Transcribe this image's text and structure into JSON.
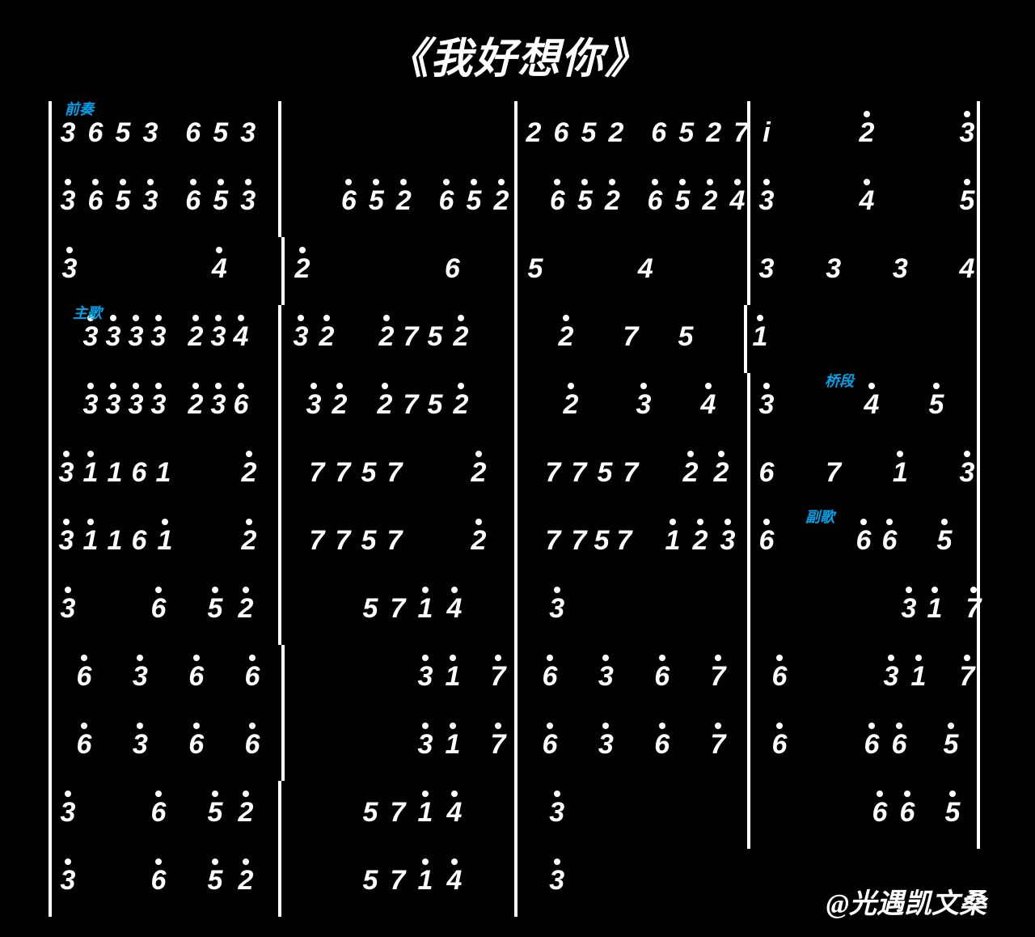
{
  "title": "《我好想你》",
  "credit": "@光遇凯文桑",
  "labels": {
    "prelude": "前奏",
    "verse": "主歌",
    "bridge": "桥段",
    "chorus": "副歌"
  },
  "barFullWidth": 288,
  "lines": [
    {
      "label": {
        "key": "prelude",
        "cls": "lbl-0"
      },
      "bars": [
        {
          "divL": true,
          "divR": true,
          "notation": "3653 653"
        },
        {
          "divL": false,
          "divR": false,
          "notation": ""
        },
        {
          "divL": true,
          "divR": false,
          "notation": "2652 6527"
        },
        {
          "divL": true,
          "divR": true,
          "notation": "i 2' 3'",
          "spread": true
        }
      ]
    },
    {
      "label": null,
      "bars": [
        {
          "divL": true,
          "divR": true,
          "notation": "3'6'5'3' 6'5'3'"
        },
        {
          "divL": false,
          "divR": false,
          "notation": "6'5'2' 6'5'2'",
          "right": true
        },
        {
          "divL": true,
          "divR": false,
          "notation": "6'5'2' 6'5'2'4'",
          "right": true
        },
        {
          "divL": true,
          "divR": true,
          "notation": "3' 4' 5'",
          "spread": true
        }
      ]
    },
    {
      "label": null,
      "bars": [
        {
          "divL": true,
          "divR": false,
          "notation": "3'   4'",
          "spread2": true
        },
        {
          "divL": true,
          "divR": false,
          "notation": "2'   6",
          "spread2": true
        },
        {
          "divL": true,
          "divR": false,
          "notation": "5  4",
          "spread2c": true
        },
        {
          "divL": true,
          "divR": true,
          "notation": "3 3 3 4",
          "spread": true
        }
      ]
    },
    {
      "label": {
        "key": "verse",
        "cls": "lbl-3"
      },
      "bars": [
        {
          "divL": true,
          "divR": true,
          "notation": " 3'3'3'3' 2'3'4'",
          "tight": true,
          "pad": 18
        },
        {
          "divL": false,
          "divR": false,
          "notation": "3'2'  2'752'",
          "custom": "c_r4a"
        },
        {
          "divL": true,
          "divR": true,
          "notation": " 2' 7 5",
          "custom": "c_r4b"
        },
        {
          "divL": false,
          "divR": true,
          "notation": "1'",
          "pad": 4
        }
      ]
    },
    {
      "label": {
        "key": "bridge",
        "cls": "lbl-4"
      },
      "bars": [
        {
          "divL": true,
          "divR": true,
          "notation": " 3'3'3'3' 2'3'6'",
          "tight": true,
          "pad": 18
        },
        {
          "divL": false,
          "divR": false,
          "notation": " 3'2' 2'752'",
          "custom": "c_r5a"
        },
        {
          "divL": true,
          "divR": false,
          "notation": " 2' 3' 4'",
          "custom": "c_r5b"
        },
        {
          "divL": true,
          "divR": true,
          "notation": "3'  4' 5'",
          "custom": "c_r5c"
        }
      ]
    },
    {
      "label": null,
      "bars": [
        {
          "divL": true,
          "divR": true,
          "notation": "3'1'161  2'",
          "custom": "c_r6a"
        },
        {
          "divL": false,
          "divR": false,
          "notation": " 7757  2'",
          "custom": "c_r6b"
        },
        {
          "divL": true,
          "divR": false,
          "notation": " 7757 2'2'",
          "custom": "c_r6c"
        },
        {
          "divL": true,
          "divR": true,
          "notation": "6 7 1' 3'",
          "spread": true
        }
      ]
    },
    {
      "label": {
        "key": "chorus",
        "cls": "lbl-6"
      },
      "bars": [
        {
          "divL": true,
          "divR": true,
          "notation": "3'1'161'  2'",
          "custom": "c_r7a"
        },
        {
          "divL": false,
          "divR": false,
          "notation": " 7757  2'",
          "custom": "c_r6b"
        },
        {
          "divL": true,
          "divR": false,
          "notation": " 7757 1'2'3'",
          "custom": "c_r7c"
        },
        {
          "divL": true,
          "divR": true,
          "notation": "6'  6'6' 5'",
          "custom": "c_r7d"
        }
      ]
    },
    {
      "label": null,
      "bars": [
        {
          "divL": true,
          "divR": true,
          "notation": "3'  6' 5'2'",
          "custom": "c_r8a"
        },
        {
          "divL": false,
          "divR": false,
          "notation": "  571' 4'",
          "custom": "c_r8b"
        },
        {
          "divL": true,
          "divR": false,
          "notation": " 3'",
          "pad": 18
        },
        {
          "divL": true,
          "divR": true,
          "notation": "   3'1' 7'",
          "custom": "c_r8d"
        }
      ]
    },
    {
      "label": null,
      "bars": [
        {
          "divL": true,
          "divR": false,
          "notation": " 6' 3' 6' 6'",
          "spreadIn": true
        },
        {
          "divL": true,
          "divR": false,
          "notation": "   3'1' 7'",
          "custom": "c_r9b"
        },
        {
          "divL": true,
          "divR": false,
          "notation": " 6' 3' 6' 7'",
          "spreadIn": true
        },
        {
          "divL": true,
          "divR": true,
          "notation": " 6'  3'1' 7'",
          "custom": "c_r9d"
        }
      ]
    },
    {
      "label": null,
      "bars": [
        {
          "divL": true,
          "divR": false,
          "notation": " 6' 3' 6' 6'",
          "spreadIn": true
        },
        {
          "divL": true,
          "divR": false,
          "notation": "   3'1' 7'",
          "custom": "c_r9b"
        },
        {
          "divL": true,
          "divR": false,
          "notation": " 6' 3' 6' 7'",
          "spreadIn": true
        },
        {
          "divL": true,
          "divR": true,
          "notation": " 6' 6'6' 5'",
          "custom": "c_r10d"
        }
      ]
    },
    {
      "label": null,
      "bars": [
        {
          "divL": true,
          "divR": true,
          "notation": "3'  6' 5'2'",
          "custom": "c_r8a"
        },
        {
          "divL": false,
          "divR": false,
          "notation": "  571' 4'",
          "custom": "c_r8b"
        },
        {
          "divL": true,
          "divR": false,
          "notation": " 3'",
          "pad": 18
        },
        {
          "divL": true,
          "divR": true,
          "notation": "   6'6' 5'",
          "custom": "c_r11d"
        }
      ]
    },
    {
      "label": null,
      "bars": [
        {
          "divL": true,
          "divR": true,
          "notation": "3'  6' 5'2'",
          "custom": "c_r8a"
        },
        {
          "divL": false,
          "divR": false,
          "notation": "  571' 4'",
          "custom": "c_r8b"
        },
        {
          "divL": true,
          "divR": false,
          "notation": " 3'",
          "pad": 18
        },
        {
          "divL": false,
          "divR": false,
          "notation": ""
        }
      ]
    }
  ]
}
